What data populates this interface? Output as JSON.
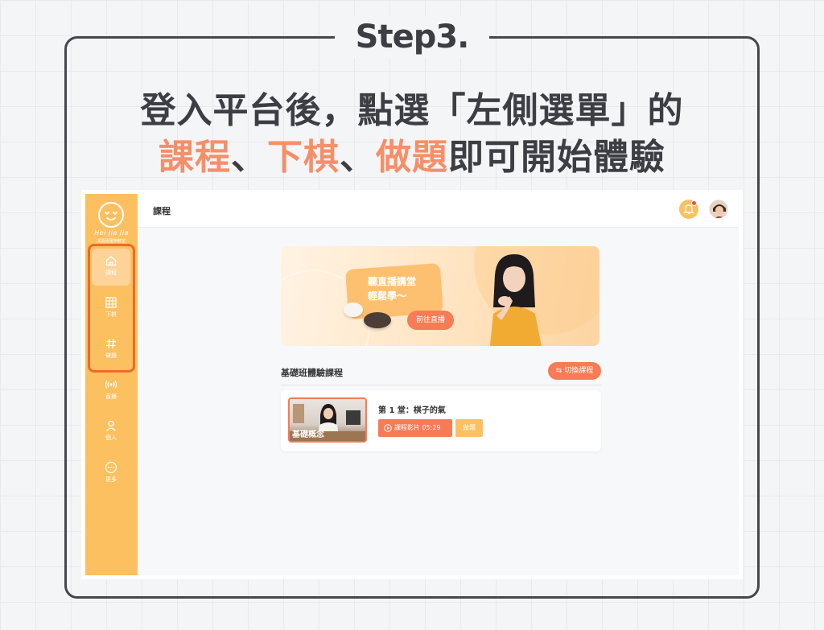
{
  "step_title": "Step3.",
  "headline": {
    "line1": "登入平台後，點選「左側選單」的",
    "line2_parts": {
      "hl1": "課程",
      "sep1": "、",
      "hl2": "下棋",
      "sep2": "、",
      "hl3": "做題",
      "rest": "即可開始體驗"
    }
  },
  "colors": {
    "accent": "#f58f68",
    "sidebar": "#fcc060",
    "highlight_border": "#ee6a2b",
    "button": "#f77b55"
  },
  "app": {
    "brand": {
      "name": "Hei Jia Jia",
      "tagline": "黑嘉嘉圍棋教室"
    },
    "sidebar": {
      "items": [
        {
          "label": "課程",
          "icon": "home-icon",
          "active": true
        },
        {
          "label": "下棋",
          "icon": "board-grid-icon",
          "active": false
        },
        {
          "label": "做題",
          "icon": "hashtag-icon",
          "active": false
        },
        {
          "label": "直播",
          "icon": "broadcast-icon",
          "active": false
        },
        {
          "label": "個人",
          "icon": "person-icon",
          "active": false
        },
        {
          "label": "更多",
          "icon": "more-icon",
          "active": false
        }
      ]
    },
    "topbar": {
      "title": "課程",
      "bell_icon": "bell-icon",
      "avatar": "user-avatar"
    },
    "banner": {
      "line1": "聽直播講堂",
      "line2": "輕鬆學～",
      "button": "前往直播"
    },
    "course_section": {
      "title": "基礎班體驗課程",
      "switch_button": "切換課程"
    },
    "lesson": {
      "thumbnail_caption": "基礎概念",
      "title": "第 1 堂：棋子的氣",
      "video_button": "課程影片 05:29",
      "quiz_button": "做題"
    }
  }
}
